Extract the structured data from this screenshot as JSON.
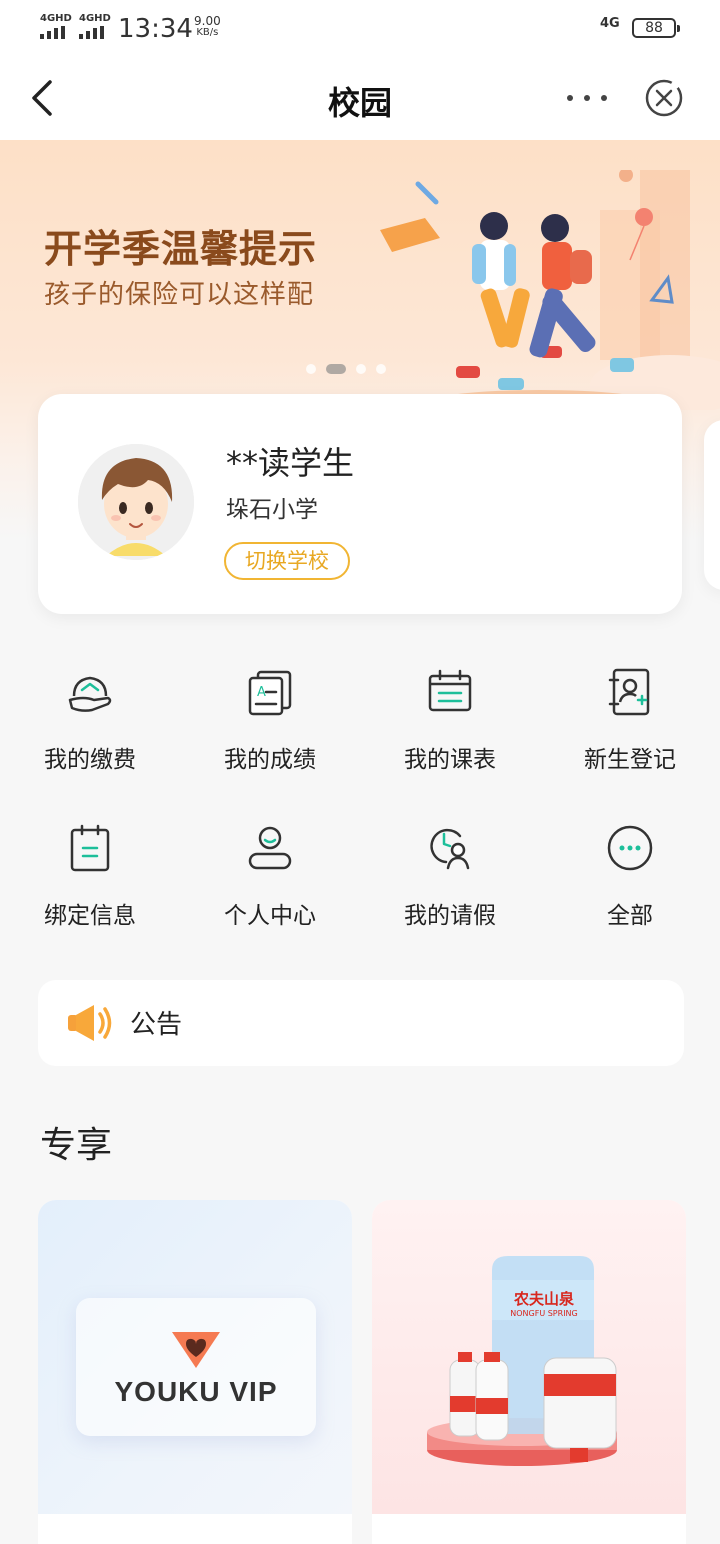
{
  "status_bar": {
    "signal_1": "4GHD",
    "signal_2": "4GHD",
    "time": "13:34",
    "speed_value": "9.00",
    "speed_unit": "KB/s",
    "network": "4G",
    "battery": "88"
  },
  "nav": {
    "title": "校园"
  },
  "banner": {
    "title": "开学季温馨提示",
    "subtitle": "孩子的保险可以这样配",
    "dots_count": 4,
    "active_dot": 2
  },
  "student_card": {
    "name": "**读学生",
    "school": "垛石小学",
    "switch_label": "切换学校"
  },
  "features": [
    {
      "label": "我的缴费",
      "icon": "payment-icon"
    },
    {
      "label": "我的成绩",
      "icon": "grades-icon"
    },
    {
      "label": "我的课表",
      "icon": "schedule-icon"
    },
    {
      "label": "新生登记",
      "icon": "register-icon"
    },
    {
      "label": "绑定信息",
      "icon": "bind-info-icon"
    },
    {
      "label": "个人中心",
      "icon": "profile-icon"
    },
    {
      "label": "我的请假",
      "icon": "leave-icon"
    },
    {
      "label": "全部",
      "icon": "more-icon"
    }
  ],
  "notice": {
    "label": "公告"
  },
  "exclusive": {
    "title": "专享",
    "items": [
      {
        "brand": "YOUKU VIP",
        "caption": ""
      },
      {
        "brand": "农夫山泉",
        "brand_en": "NONGFU SPRING",
        "caption": ""
      }
    ]
  },
  "colors": {
    "accent_green": "#1dbf9a",
    "accent_yellow": "#f1b533",
    "banner_text": "#8a4a1c"
  }
}
